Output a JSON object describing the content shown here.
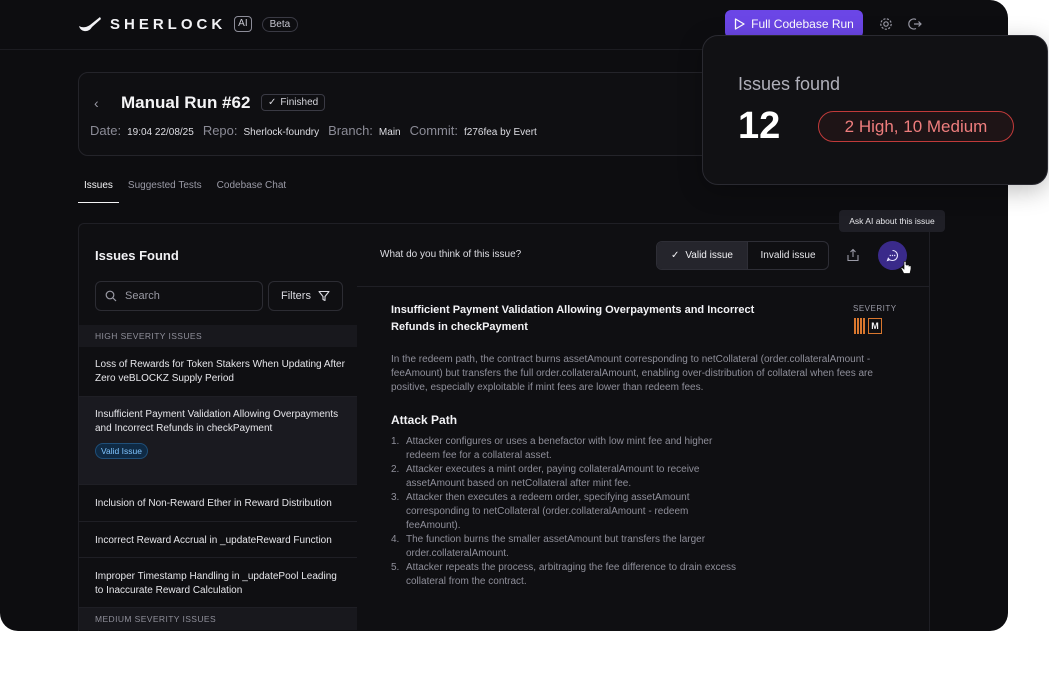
{
  "header": {
    "logo_text": "SHERLOCK",
    "logo_ai": "AI",
    "beta": "Beta",
    "run_button": "Full Codebase Run"
  },
  "run": {
    "title": "Manual Run #62",
    "status": "Finished",
    "date_label": "Date:",
    "date": "19:04 22/08/25",
    "repo_label": "Repo:",
    "repo": "Sherlock-foundry",
    "branch_label": "Branch:",
    "branch": "Main",
    "commit_label": "Commit:",
    "commit": "f276fea by Evert"
  },
  "tabs": [
    "Issues",
    "Suggested Tests",
    "Codebase Chat"
  ],
  "issues_panel": {
    "title": "Issues Found",
    "search_placeholder": "Search",
    "filters_label": "Filters",
    "high_header": "HIGH SEVERITY ISSUES",
    "medium_header": "MEDIUM SEVERITY ISSUES",
    "items": [
      {
        "title": "Loss of Rewards for Token Stakers When Updating After Zero veBLOCKZ Supply Period"
      },
      {
        "title": "Insufficient Payment Validation Allowing Overpayments and Incorrect Refunds in checkPayment",
        "badge": "Valid Issue"
      },
      {
        "title": "Inclusion of Non-Reward Ether in Reward Distribution"
      },
      {
        "title": "Incorrect Reward Accrual in _updateReward Function"
      },
      {
        "title": "Improper Timestamp Handling in _updatePool Leading to Inaccurate Reward Calculation"
      }
    ]
  },
  "detail": {
    "question": "What do you think of this issue?",
    "valid_label": "Valid issue",
    "invalid_label": "Invalid issue",
    "tooltip": "Ask AI about this issue",
    "title": "Insufficient Payment Validation Allowing Overpayments and Incorrect Refunds in checkPayment",
    "severity_label": "SEVERITY",
    "severity_value": "M",
    "description": "In the redeem path, the contract burns assetAmount corresponding to  netCollateral (order.collateralAmount - feeAmount) but transfers the  full order.collateralAmount, enabling over-distribution of collateral  when fees are positive, especially exploitable if mint fees are lower  than redeem fees.",
    "attack_title": "Attack Path",
    "steps": [
      "Attacker configures or uses a benefactor with low mint fee and higher redeem fee for a collateral asset.",
      "Attacker executes a mint order, paying collateralAmount to receive assetAmount based on netCollateral after mint fee.",
      "Attacker then executes a redeem order, specifying assetAmount corresponding to netCollateral (order.collateralAmount - redeem feeAmount).",
      "The function burns the smaller assetAmount but transfers the larger order.collateralAmount.",
      "Attacker repeats the process, arbitraging the fee difference to drain excess collateral from the contract."
    ]
  },
  "summary_card": {
    "label": "Issues found",
    "count": "12",
    "breakdown": "2 High, 10 Medium"
  },
  "colors": {
    "accent": "#6b46e6",
    "severity_medium": "#d9772e",
    "high_pill": "#c03a3a"
  }
}
